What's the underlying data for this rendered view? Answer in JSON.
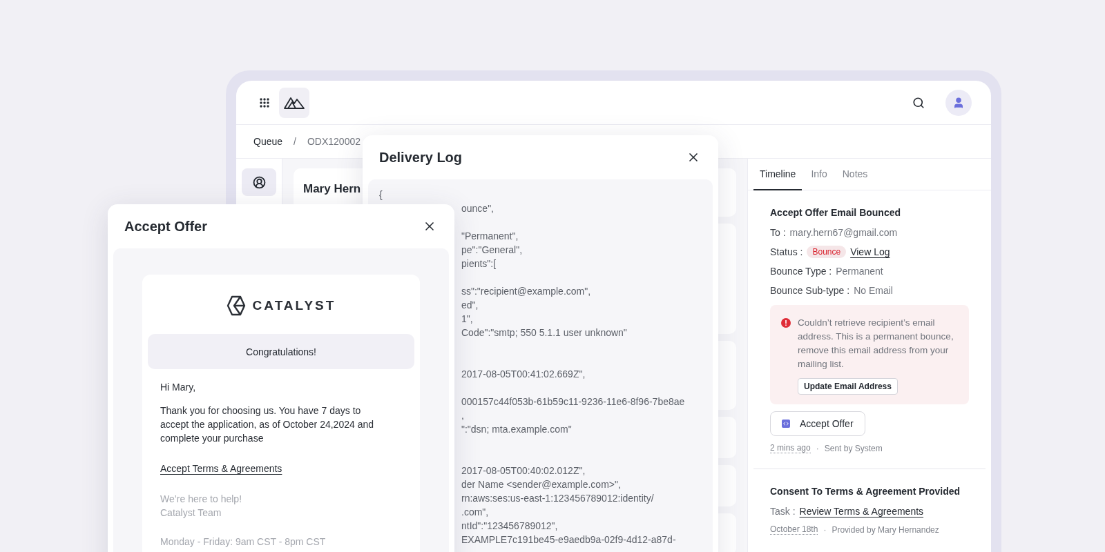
{
  "app": {
    "breadcrumb": {
      "items": [
        {
          "label": "Queue"
        },
        {
          "label": "ODX120002"
        }
      ],
      "separator": "/"
    },
    "customer_card": {
      "name": "Mary Hern"
    },
    "side_panel": {
      "tabs": [
        {
          "label": "Timeline",
          "selected": true
        },
        {
          "label": "Info",
          "selected": false
        },
        {
          "label": "Notes",
          "selected": false
        }
      ],
      "events": [
        {
          "title": "Accept Offer Email Bounced",
          "fields": [
            {
              "kind": "text",
              "label": "To :",
              "value": "mary.hern67@gmail.com"
            },
            {
              "kind": "status",
              "label": "Status :",
              "badge": "Bounce",
              "link": "View Log"
            },
            {
              "kind": "text",
              "label": "Bounce Type :",
              "value": "Permanent"
            },
            {
              "kind": "text",
              "label": "Bounce Sub-type :",
              "value": "No Email"
            }
          ],
          "alert": {
            "message": "Couldn’t retrieve recipient’s email address. This is a permanent bounce, remove this email address from your mailing list.",
            "action": "Update Email Address"
          },
          "attachment": "Accept Offer",
          "meta": [
            "2 mins ago",
            "Sent by System"
          ],
          "meta_separator": "·"
        },
        {
          "title": "Consent To Terms & Agreement Provided",
          "fields": [
            {
              "kind": "link",
              "label": "Task :",
              "value": "Review Terms & Agreements"
            }
          ],
          "meta": [
            "October 18th",
            "Provided by  Mary Hernandez"
          ],
          "meta_separator": "·"
        }
      ]
    }
  },
  "delivery_log": {
    "title": "Delivery Log",
    "lines": [
      {
        "kind": "full",
        "text": "{"
      },
      {
        "kind": "clipped",
        "text": "ounce\","
      },
      {
        "kind": "blank"
      },
      {
        "kind": "clipped",
        "text": "\"Permanent\","
      },
      {
        "kind": "clipped",
        "text": "pe\":\"General\","
      },
      {
        "kind": "clipped",
        "text": "pients\":["
      },
      {
        "kind": "blank"
      },
      {
        "kind": "clipped",
        "text": "ss\":\"recipient@example.com\","
      },
      {
        "kind": "clipped",
        "text": "ed\","
      },
      {
        "kind": "clipped",
        "text": "1\","
      },
      {
        "kind": "clipped",
        "text": "Code\":\"smtp; 550 5.1.1 user unknown\""
      },
      {
        "kind": "blank"
      },
      {
        "kind": "blank"
      },
      {
        "kind": "clipped",
        "text": "2017-08-05T00:41:02.669Z\","
      },
      {
        "kind": "blank"
      },
      {
        "kind": "clipped",
        "text": "000157c44f053b-61b59c11-9236-11e6-8f96-7be8ae"
      },
      {
        "kind": "clipped",
        "text": ","
      },
      {
        "kind": "clipped",
        "text": "\":\"dsn; mta.example.com\""
      },
      {
        "kind": "blank"
      },
      {
        "kind": "blank"
      },
      {
        "kind": "clipped",
        "text": "2017-08-05T00:40:02.012Z\","
      },
      {
        "kind": "clipped",
        "text": "der Name <sender@example.com>\","
      },
      {
        "kind": "clipped",
        "text": "rn:aws:ses:us-east-1:123456789012:identity/"
      },
      {
        "kind": "clipped",
        "text": ".com\","
      },
      {
        "kind": "clipped",
        "text": "ntId\":\"123456789012\","
      },
      {
        "kind": "clipped",
        "text": "EXAMPLE7c191be45-e9aedb9a-02f9-4d12-a87d-"
      }
    ]
  },
  "accept_offer": {
    "title": "Accept Offer",
    "email": {
      "logo_text": "CATALYST",
      "banner": "Congratulations!",
      "greeting": "Hi Mary,",
      "body": "Thank you for choosing us. You have 7 days to accept the application, as of October 24,2024 and complete your purchase",
      "link": "Accept Terms & Agreements",
      "signoff": [
        "We’re here to help!",
        "Catalyst Team"
      ],
      "hours": "Monday - Friday:  9am CST - 8pm CST"
    }
  }
}
